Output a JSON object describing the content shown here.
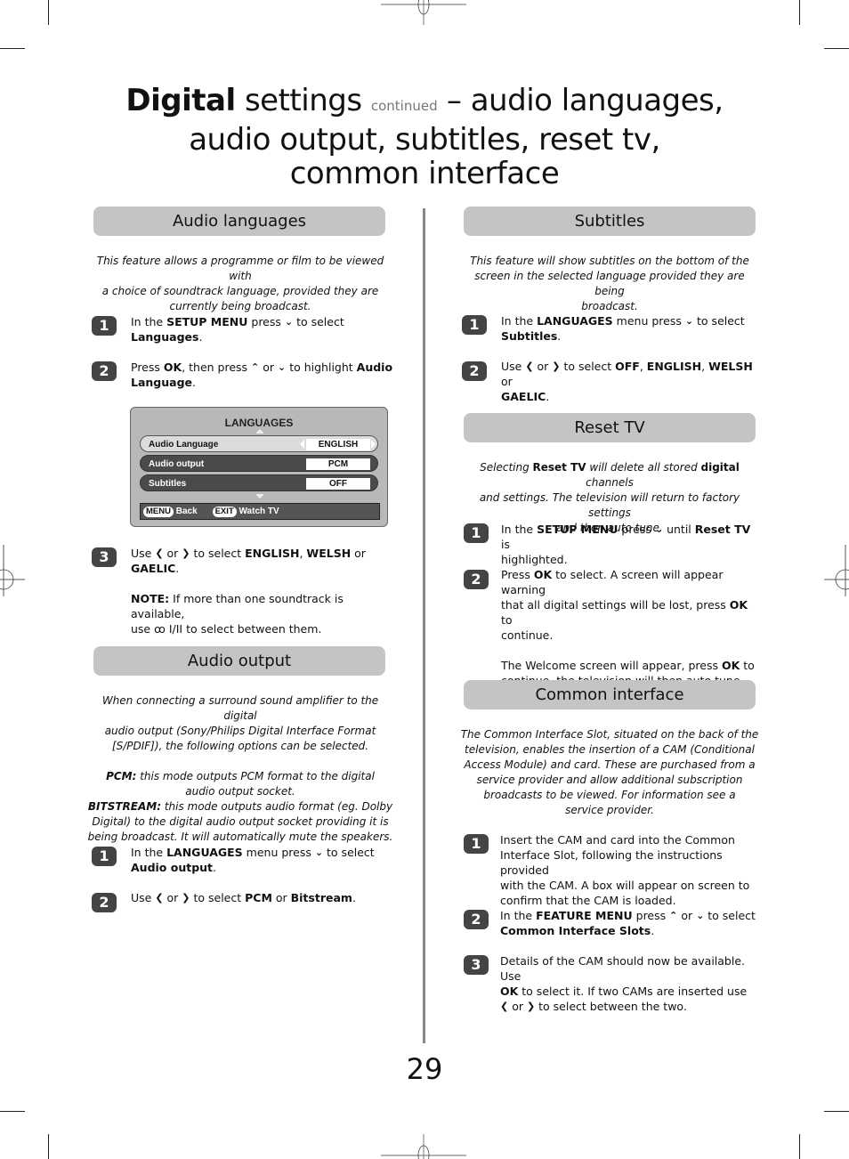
{
  "title": {
    "bold": "Digital",
    "part1": " settings ",
    "continued": "continued",
    "line1_rest": " – audio languages,",
    "line2": "audio output, subtitles, reset tv,",
    "line3": "common interface"
  },
  "sections": {
    "audio_languages": {
      "header": "Audio languages",
      "intro": [
        "This feature allows a programme or film to be viewed with",
        "a choice of soundtrack language, provided they are",
        "currently being broadcast."
      ],
      "steps": [
        {
          "num": "1",
          "t1": "In the ",
          "b1": "SETUP MENU",
          "t2": " press ",
          "t3": " to select",
          "b2": "Languages",
          "t4": "."
        },
        {
          "num": "2",
          "t1": "Press ",
          "b1": "OK",
          "t2": ", then press ",
          "t3": " or ",
          "t4": " to highlight ",
          "b2": "Audio",
          "b3": "Language",
          "t5": "."
        },
        {
          "num": "3",
          "t1": "Use ",
          "t2": " or ",
          "t3": " to select ",
          "b1": "ENGLISH",
          "t4": ", ",
          "b2": "WELSH",
          "t5": " or",
          "b3": "GAELIC",
          "t6": "."
        }
      ],
      "note": {
        "label": "NOTE:",
        "t1": " If more than one soundtrack is available,",
        "t2": "use ",
        "dual": "ꝏ I/II",
        "t3": " to select between them."
      }
    },
    "tv_menu": {
      "title": "LANGUAGES",
      "rows": [
        {
          "label": "Audio Language",
          "value": "ENGLISH"
        },
        {
          "label": "Audio output",
          "value": "PCM"
        },
        {
          "label": "Subtitles",
          "value": "OFF"
        }
      ],
      "footer": {
        "menu_key": "MENU",
        "menu_label": "Back",
        "exit_key": "EXIT",
        "exit_label": "Watch TV"
      }
    },
    "audio_output": {
      "header": "Audio output",
      "intro": [
        "When connecting a surround sound amplifier to the digital",
        "audio output (Sony/Philips Digital Interface Format",
        "[S/PDIF]), the following options can be selected."
      ],
      "pcm": {
        "label": "PCM:",
        "l1": " this mode outputs PCM format to the digital",
        "l2": "audio output socket."
      },
      "bitstream": {
        "label": "BITSTREAM:",
        "l1": " this mode outputs audio format (eg. Dolby",
        "l2": "Digital) to the digital audio output socket providing it is",
        "l3": "being broadcast. It will automatically mute the speakers."
      },
      "steps": [
        {
          "num": "1",
          "t1": "In the ",
          "b1": "LANGUAGES",
          "t2": " menu press ",
          "t3": " to select",
          "b2": "Audio output",
          "t4": "."
        },
        {
          "num": "2",
          "t1": "Use ",
          "t2": " or ",
          "t3": " to select ",
          "b1": "PCM",
          "t4": " or ",
          "b2": "Bitstream",
          "t5": "."
        }
      ]
    },
    "subtitles": {
      "header": "Subtitles",
      "intro": [
        "This feature will show subtitles on the bottom of the",
        "screen in the selected language provided they are being",
        "broadcast."
      ],
      "steps": [
        {
          "num": "1",
          "t1": "In the ",
          "b1": "LANGUAGES",
          "t2": " menu press ",
          "t3": " to select",
          "b2": "Subtitles",
          "t4": "."
        },
        {
          "num": "2",
          "t1": "Use ",
          "t2": " or ",
          "t3": " to select ",
          "b1": "OFF",
          "t4": ", ",
          "b2": "ENGLISH",
          "t5": ", ",
          "b3": "WELSH",
          "t6": " or",
          "b4": "GAELIC",
          "t7": "."
        }
      ]
    },
    "reset_tv": {
      "header": "Reset TV",
      "intro": {
        "t1": "Selecting ",
        "b1": "Reset TV",
        "t2": " will delete all stored ",
        "b2": "digital",
        "t3": " channels",
        "l2": "and settings. The television will return to factory settings",
        "l3": "and then auto tune."
      },
      "steps": [
        {
          "num": "1",
          "t1": "In the ",
          "b1": "SETUP MENU",
          "t2": " press ",
          "t3": " until ",
          "b2": "Reset TV",
          "t4": " is",
          "l2": "highlighted."
        },
        {
          "num": "2",
          "t1": "Press ",
          "b1": "OK",
          "t2": " to select. A screen will appear warning",
          "l2a": "that all digital settings will be lost, press ",
          "b2": "OK",
          "l2b": " to",
          "l3": "continue.",
          "p2a": "The Welcome screen will appear, press ",
          "b3": "OK",
          "p2b": " to",
          "p2c": "continue, the television will then auto tune."
        }
      ]
    },
    "common_interface": {
      "header": "Common interface",
      "intro": [
        "The Common Interface Slot, situated on the back of the",
        "television, enables the insertion of a CAM (Conditional",
        "Access Module) and card. These are purchased from a",
        "service provider and allow additional subscription",
        "broadcasts to be viewed. For information see a",
        "service provider."
      ],
      "steps": [
        {
          "num": "1",
          "lines": [
            "Insert the CAM and card into the Common",
            "Interface Slot, following the instructions provided",
            "with the CAM. A box will appear on screen to",
            "confirm that the CAM is loaded."
          ]
        },
        {
          "num": "2",
          "t1": "In the ",
          "b1": "FEATURE MENU",
          "t2": " press ",
          "t3": " or ",
          "t4": " to select",
          "b2": "Common Interface Slots",
          "t5": "."
        },
        {
          "num": "3",
          "l1": "Details of the CAM should now be available. Use",
          "b1": "OK",
          "l2": " to select it. If two CAMs are inserted use",
          "t1": " or ",
          "t2": " to select between the two."
        }
      ]
    }
  },
  "icons": {
    "down": "⌄",
    "up": "⌃",
    "left": "❮",
    "right": "❯"
  },
  "page_number": "29"
}
